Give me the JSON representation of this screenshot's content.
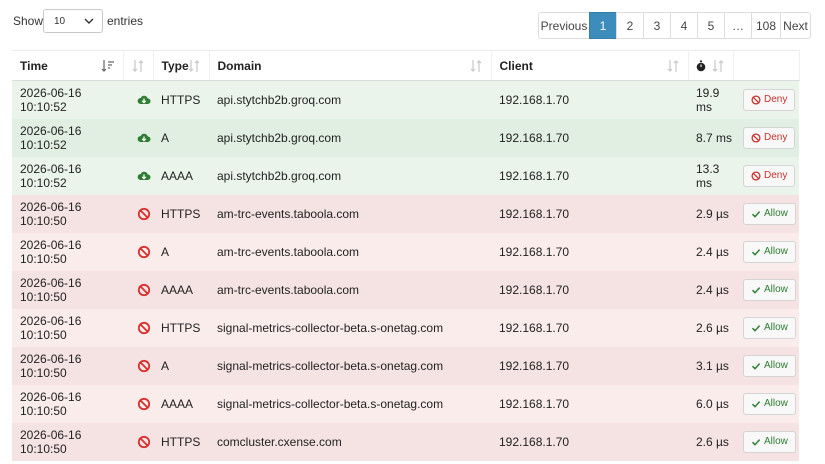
{
  "length_control": {
    "show_label": "Show",
    "selected": "10",
    "entries_label": "entries"
  },
  "pagination": {
    "previous": "Previous",
    "pages": [
      "1",
      "2",
      "3",
      "4",
      "5",
      "…",
      "108"
    ],
    "active": "1",
    "next": "Next"
  },
  "table": {
    "headers": {
      "time": "Time",
      "type": "Type",
      "domain": "Domain",
      "client": "Client"
    },
    "rows": [
      {
        "time": "2026-06-16 10:10:52",
        "status": "ok",
        "type": "HTTPS",
        "domain": "api.stytchb2b.groq.com",
        "client": "192.168.1.70",
        "duration": "19.9 ms",
        "action": "Deny"
      },
      {
        "time": "2026-06-16 10:10:52",
        "status": "ok",
        "type": "A",
        "domain": "api.stytchb2b.groq.com",
        "client": "192.168.1.70",
        "duration": "8.7 ms",
        "action": "Deny"
      },
      {
        "time": "2026-06-16 10:10:52",
        "status": "ok",
        "type": "AAAA",
        "domain": "api.stytchb2b.groq.com",
        "client": "192.168.1.70",
        "duration": "13.3 ms",
        "action": "Deny"
      },
      {
        "time": "2026-06-16 10:10:50",
        "status": "blocked",
        "type": "HTTPS",
        "domain": "am-trc-events.taboola.com",
        "client": "192.168.1.70",
        "duration": "2.9 µs",
        "action": "Allow"
      },
      {
        "time": "2026-06-16 10:10:50",
        "status": "blocked",
        "type": "A",
        "domain": "am-trc-events.taboola.com",
        "client": "192.168.1.70",
        "duration": "2.4 µs",
        "action": "Allow"
      },
      {
        "time": "2026-06-16 10:10:50",
        "status": "blocked",
        "type": "AAAA",
        "domain": "am-trc-events.taboola.com",
        "client": "192.168.1.70",
        "duration": "2.4 µs",
        "action": "Allow"
      },
      {
        "time": "2026-06-16 10:10:50",
        "status": "blocked",
        "type": "HTTPS",
        "domain": "signal-metrics-collector-beta.s-onetag.com",
        "client": "192.168.1.70",
        "duration": "2.6 µs",
        "action": "Allow"
      },
      {
        "time": "2026-06-16 10:10:50",
        "status": "blocked",
        "type": "A",
        "domain": "signal-metrics-collector-beta.s-onetag.com",
        "client": "192.168.1.70",
        "duration": "3.1 µs",
        "action": "Allow"
      },
      {
        "time": "2026-06-16 10:10:50",
        "status": "blocked",
        "type": "AAAA",
        "domain": "signal-metrics-collector-beta.s-onetag.com",
        "client": "192.168.1.70",
        "duration": "6.0 µs",
        "action": "Allow"
      },
      {
        "time": "2026-06-16 10:10:50",
        "status": "blocked",
        "type": "HTTPS",
        "domain": "comcluster.cxense.com",
        "client": "192.168.1.70",
        "duration": "2.6 µs",
        "action": "Allow"
      }
    ]
  },
  "icons": {
    "ok_status": "cloud-download-icon",
    "blocked_status": "ban-icon",
    "duration_header": "stopwatch-icon",
    "deny_button": "ban-icon",
    "allow_button": "check-icon"
  },
  "colors": {
    "accent": "#3c8dbc",
    "ok_row": "#eaf4eb",
    "blocked_row": "#fbecec",
    "ok_icon": "#2e7d32",
    "blocked_icon": "#d9322c"
  }
}
